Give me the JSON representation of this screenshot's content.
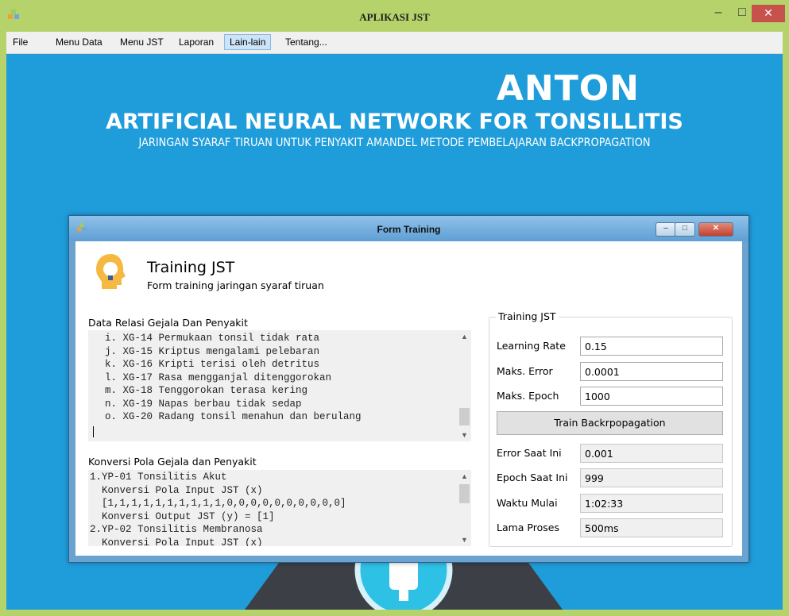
{
  "window": {
    "title": "APLIKASI JST",
    "minimize_glyph": "–",
    "maximize_glyph": "□",
    "close_glyph": "✕"
  },
  "menu": {
    "items": [
      {
        "label": "File"
      },
      {
        "label": "Menu Data"
      },
      {
        "label": "Menu JST"
      },
      {
        "label": "Laporan"
      },
      {
        "label": "Lain-lain",
        "active": true
      },
      {
        "label": "Tentang..."
      }
    ]
  },
  "banner": {
    "name": "ANTON",
    "title": "ARTIFICIAL NEURAL NETWORK FOR TONSILLITIS",
    "subtitle": "JARINGAN SYARAF TIRUAN UNTUK PENYAKIT AMANDEL METODE PEMBELAJARAN BACKPROPAGATION"
  },
  "form": {
    "title": "Form Training",
    "header_title": "Training JST",
    "header_subtitle": "Form training jaringan syaraf tiruan",
    "relasi": {
      "label": "Data Relasi Gejala Dan Penyakit",
      "lines": [
        "  i. XG-14 Permukaan tonsil tidak rata",
        "  j. XG-15 Kriptus mengalami pelebaran",
        "  k. XG-16 Kripti terisi oleh detritus",
        "  l. XG-17 Rasa mengganjal ditenggorokan",
        "  m. XG-18 Tenggorokan terasa kering",
        "  n. XG-19 Napas berbau tidak sedap",
        "  o. XG-20 Radang tonsil menahun dan berulang"
      ]
    },
    "konversi": {
      "label": "Konversi Pola Gejala dan Penyakit",
      "lines": [
        "1.YP-01 Tonsilitis Akut",
        "  Konversi Pola Input JST (x)",
        "  [1,1,1,1,1,1,1,1,1,1,0,0,0,0,0,0,0,0,0,0]",
        "  Konversi Output JST (y) = [1]",
        "2.YP-02 Tonsilitis Membranosa",
        "  Konversi Pola Input JST (x)"
      ]
    },
    "training": {
      "group_label": "Training JST",
      "learning_rate_label": "Learning Rate",
      "learning_rate": "0.15",
      "max_error_label": "Maks. Error",
      "max_error": "0.0001",
      "max_epoch_label": "Maks. Epoch",
      "max_epoch": "1000",
      "train_button": "Train Backrpopagation",
      "error_now_label": "Error Saat Ini",
      "error_now": "0.001",
      "epoch_now_label": "Epoch Saat Ini",
      "epoch_now": "999",
      "start_time_label": "Waktu Mulai",
      "start_time": "1:02:33",
      "duration_label": "Lama Proses",
      "duration": "500ms"
    }
  },
  "colors": {
    "outer_frame": "#b6d26b",
    "desktop_bg": "#1f9ddb",
    "close_red": "#c7514b"
  },
  "icons": {
    "app": "app-icon",
    "header": "lightbulb-head-icon"
  }
}
